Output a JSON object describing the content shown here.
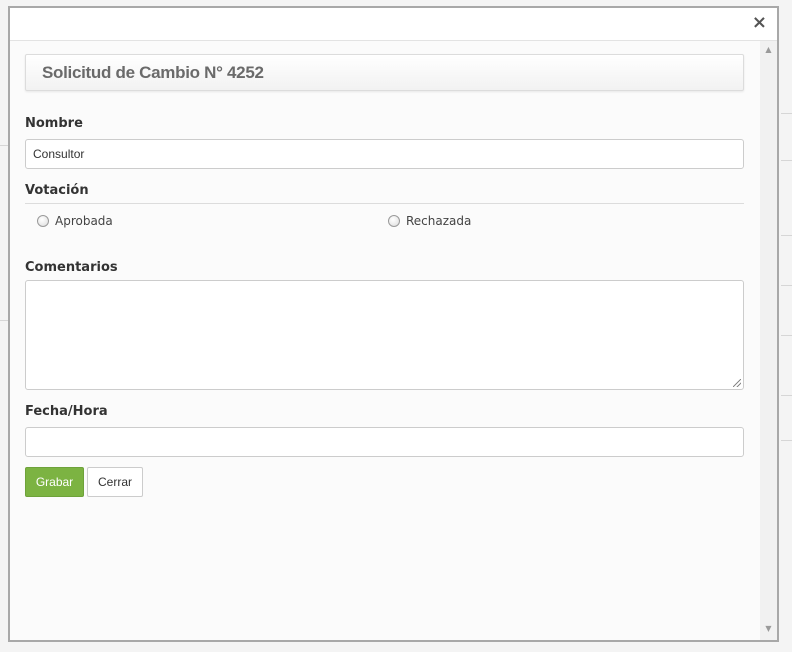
{
  "dialog": {
    "close_glyph": "×",
    "title": "Solicitud de Cambio N° 4252"
  },
  "form": {
    "nombre_label": "Nombre",
    "nombre_value": "Consultor",
    "votacion_label": "Votación",
    "options": [
      {
        "label": "Aprobada",
        "selected": false
      },
      {
        "label": "Rechazada",
        "selected": false
      }
    ],
    "comentarios_label": "Comentarios",
    "comentarios_value": "",
    "fecha_label": "Fecha/Hora",
    "fecha_value": ""
  },
  "buttons": {
    "save_label": "Grabar",
    "close_label": "Cerrar"
  },
  "scrollbar": {
    "up_glyph": "▲",
    "down_glyph": "▼"
  },
  "colors": {
    "save_button": "#7cb342",
    "title_text": "#6a6a6a"
  }
}
